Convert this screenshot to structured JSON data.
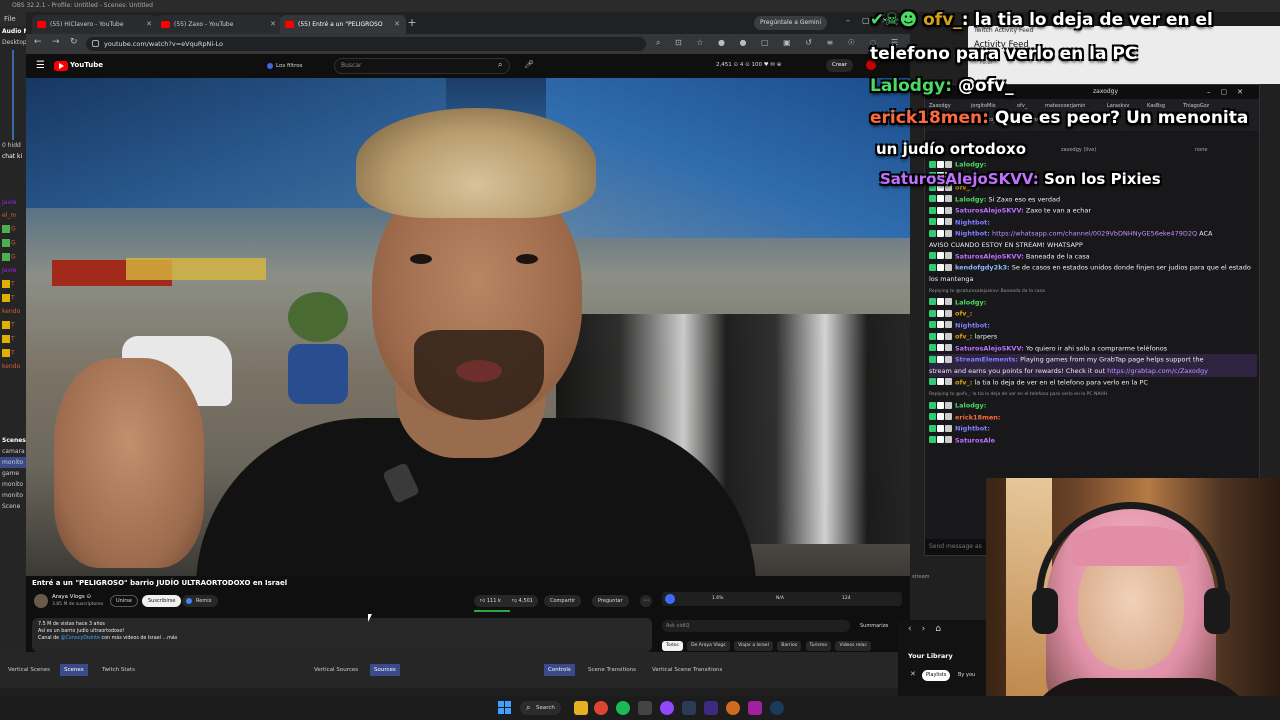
{
  "obs": {
    "title": "OBS 32.2.1 - Profile: Untitled - Scenes: Untitled",
    "menu_file": "File",
    "left_panel": {
      "audio_label": "Audio M",
      "desktop_label": "Desktop",
      "hidden_label": "0 hidd",
      "chat_label": "chat ki",
      "chat_names": [
        "Javie",
        "el_m",
        "G",
        "G",
        "G",
        "Javie",
        "T",
        "T",
        "kendo",
        "T",
        "T",
        "T",
        "kendo"
      ],
      "scenes_label": "Scenes",
      "scene_items": [
        "camara",
        "monito",
        "game",
        "monito",
        "monito",
        "Scene"
      ]
    },
    "dock_tabs": [
      "Vertical Scenes",
      "Scenes",
      "Twitch Stats",
      "Vertical Sources",
      "Sources",
      "Controls",
      "Scene Transitions",
      "Vertical Scene Transitions"
    ],
    "stream_label": "stream"
  },
  "browser": {
    "tabs": [
      {
        "label": "(55) HiClavero - YouTube"
      },
      {
        "label": "(55) Zaxo - YouTube"
      },
      {
        "label": "(55) Entré a un \"PELIGROSO"
      }
    ],
    "gemini_label": "Pregúntale a Gemini",
    "url": "youtube.com/watch?v=eVquRpNi-Lo"
  },
  "youtube": {
    "logo_text": "YouTube",
    "filters_label": "Los filtros",
    "search_placeholder": "Buscar",
    "header_stats": "2,451  ⊙ 4  ⊙ 100  ♥ ✉ ⊕",
    "create_label": "Crear",
    "video_title": "Entré a un \"PELIGROSO\" barrio JUDÍO ULTRAORTODOXO en Israel",
    "channel_name": "Araya Vlogs ⊙",
    "channel_subs": "3.85 M de suscriptores",
    "join_label": "Unirse",
    "subscribe_label": "Suscribirse",
    "remix_label": "Remix",
    "likes": "111 k",
    "dislikes": "4,501",
    "share_label": "Compartir",
    "ask_label": "Preguntar",
    "description": {
      "line1": "7.5 M de vistas  hace 3 años",
      "line2": "Así es un barrio judío ultraortodoxo!",
      "line3_pre": "Canal de ",
      "line3_link": "@ConocyDisinte",
      "line3_post": " con más videos de Israel  ...más"
    },
    "control_strip": {
      "v1": "1.6%",
      "v2": "N/A",
      "v3": "124"
    },
    "ask_placeholder": "Ask vidIQ",
    "summarize_label": "Summarize",
    "chips": [
      "Todos",
      "De Araya Vlogs",
      "Viajar a Israel",
      "Barrios",
      "Turismo",
      "Videos relac"
    ]
  },
  "activity": {
    "window_title": "Twitch Activity Feed",
    "title": "Activity Feed",
    "filter_label": "Filter"
  },
  "chat": {
    "window_title": "zaxodgy",
    "tabs": [
      "Zaxodgy",
      "jorgitoMix",
      "ofv_",
      "matescoerjamin",
      "Laraskvv",
      "KasBsg",
      "ThiagoGzz",
      "Sstrancho",
      "satirico_",
      "elmamanu"
    ],
    "channel_bar": "zaxodgy (live)",
    "none_label": "none",
    "input_placeholder": "Send message as",
    "lines": [
      {
        "user": "Lalodgy:",
        "color": "#4cd964",
        "msg": ""
      },
      {
        "user": "Nightbot:",
        "color": "#7f7fff",
        "msg": ""
      },
      {
        "user": "ofv_:",
        "color": "#d4a017",
        "msg": "✌"
      },
      {
        "user": "Lalodgy:",
        "color": "#4cd964",
        "msg": "Si Zaxo eso es verdad"
      },
      {
        "user": "SaturosAlejoSKVV:",
        "color": "#c070ff",
        "msg": "Zaxo te van a echar"
      },
      {
        "user": "Nightbot:",
        "color": "#7f7fff",
        "msg": ""
      },
      {
        "user": "Nightbot:",
        "color": "#7f7fff",
        "msg": "",
        "link": "https://whatsapp.com/channel/0029VbDNHNyGE56eke479D2Q",
        "post": " ACA"
      },
      {
        "user": "",
        "color": "#fff",
        "msg": "AVISO CUANDO ESTOY EN STREAM! WHATSAPP"
      },
      {
        "user": "SaturosAlejoSKVV:",
        "color": "#c070ff",
        "msg": "Baneada de la casa"
      },
      {
        "user": "kendofgdy2k3:",
        "color": "#8bb8ff",
        "msg": "Se de casos en estados unidos donde finjen ser judios para que el estado"
      },
      {
        "user": "",
        "color": "#fff",
        "msg": "los mantenga"
      },
      {
        "reply": "Replying to @saturosalejoskvv: Baneada de la casa"
      },
      {
        "user": "Lalodgy:",
        "color": "#4cd964",
        "msg": ""
      },
      {
        "user": "ofv_:",
        "color": "#d4a017",
        "msg": ""
      },
      {
        "user": "Nightbot:",
        "color": "#7f7fff",
        "msg": ""
      },
      {
        "user": "ofv_:",
        "color": "#d4a017",
        "msg": "larpers"
      },
      {
        "user": "SaturosAlejoSKVV:",
        "color": "#c070ff",
        "msg": "Yo quiero ir ahi solo a comprarme teléfonos"
      },
      {
        "user": "StreamElements:",
        "color": "#7f7fff",
        "msg": "Playing games from my GrabTap page helps support the",
        "hl": true
      },
      {
        "user": "",
        "color": "#fff",
        "msg": "stream and earns you points for rewards! Check it out",
        "link": "https://grabtap.com/c/Zaxodgy",
        "hl": true
      },
      {
        "user": "ofv_:",
        "color": "#d4a017",
        "msg": "la tia lo deja de ver en el telefono para verlo en la PC"
      },
      {
        "reply": "Replying to @ofv_: la tia lo deja de ver en el telefono para verlo en la PC NAHH"
      },
      {
        "user": "Lalodgy:",
        "color": "#4cd964",
        "msg": ""
      },
      {
        "user": "erick18men:",
        "color": "#ff6a3d",
        "msg": ""
      },
      {
        "user": "Nightbot:",
        "color": "#7f7fff",
        "msg": ""
      },
      {
        "user": "SaturosAle",
        "color": "#c070ff",
        "msg": ""
      }
    ]
  },
  "overlay": {
    "l1_user": "ofv_",
    "l1_msg": ": la tia lo deja de ver en el",
    "l2": "telefono para verlo en la PC",
    "l3_user": "Lalodgy:",
    "l3_msg": "@ofv_",
    "l4_user": "erick18men:",
    "l4_msg": " Que es peor? Un menonita",
    "l5": "un judío ortodoxo",
    "l6_user": "SaturosAlejoSKVV:",
    "l6_msg": " Son los Pixies"
  },
  "library": {
    "title": "Your Library",
    "playlists": "Playlists",
    "by_you": "By you"
  },
  "taskbar": {
    "search_label": "Search"
  },
  "colors": {
    "youtube_red": "#ff0000",
    "twitch_bg": "#18181b",
    "overlay_green": "#4cd964",
    "overlay_orange": "#ff6a3d",
    "overlay_purple": "#c070ff"
  }
}
